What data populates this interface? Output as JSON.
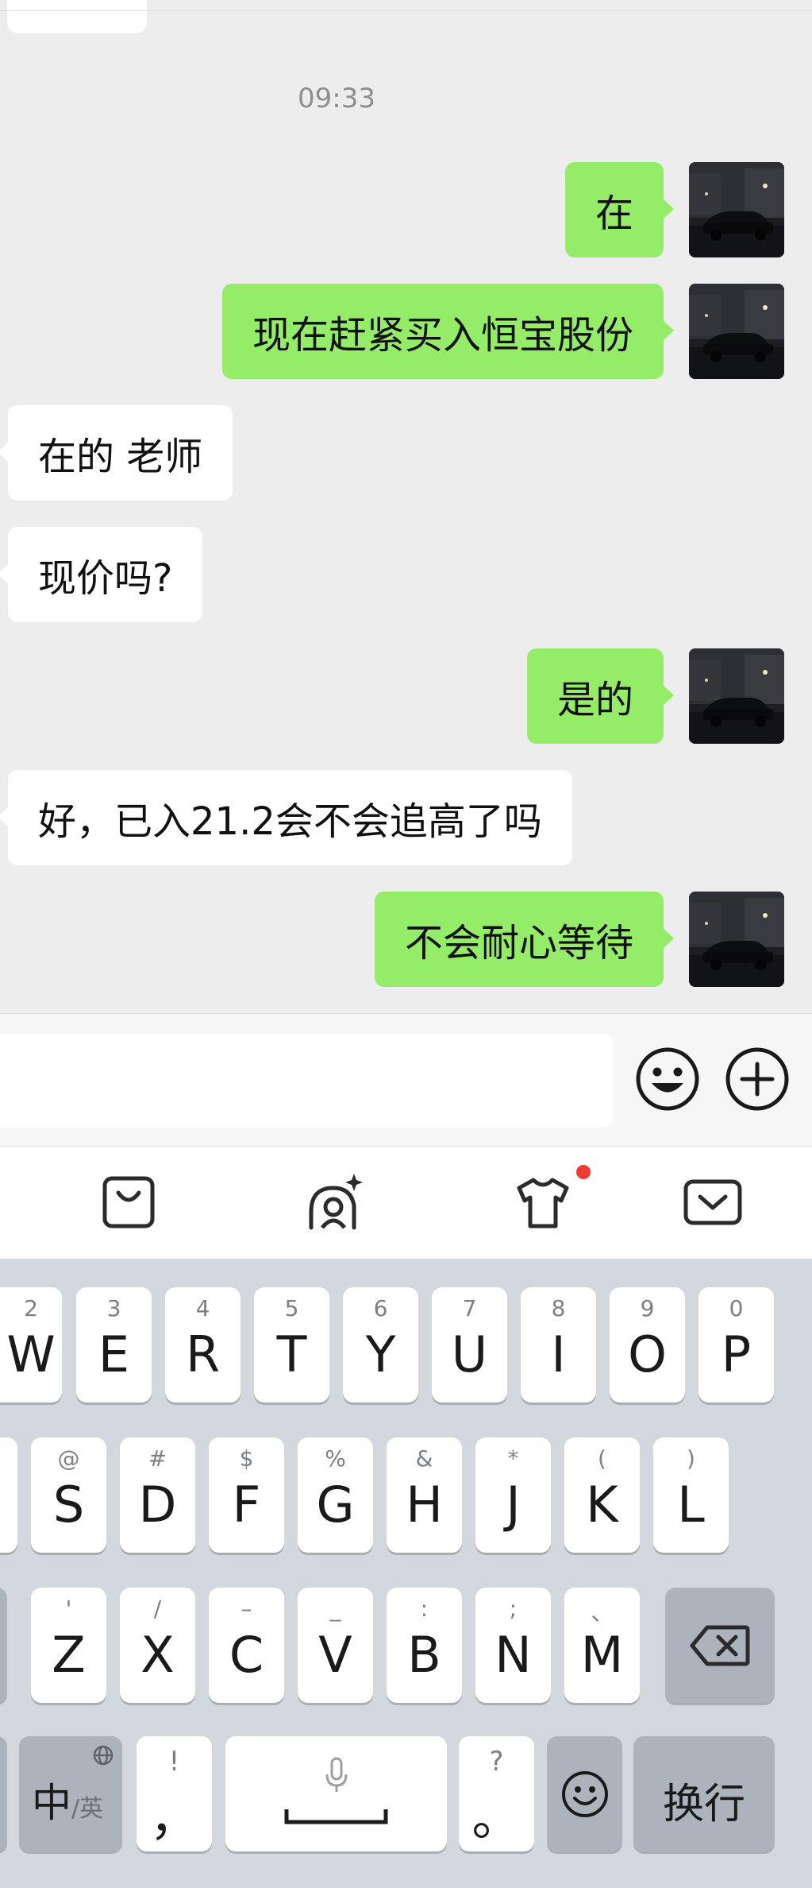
{
  "chat": {
    "timestamp": "09:33",
    "messages": [
      {
        "direction": "outgoing",
        "text": "在"
      },
      {
        "direction": "outgoing",
        "text": "现在赶紧买入恒宝股份"
      },
      {
        "direction": "incoming",
        "text": "在的 老师"
      },
      {
        "direction": "incoming",
        "text": "现价吗?"
      },
      {
        "direction": "outgoing",
        "text": "是的"
      },
      {
        "direction": "incoming",
        "text": "好，已入21.2会不会追高了吗"
      },
      {
        "direction": "outgoing",
        "text": "不会耐心等待"
      }
    ]
  },
  "input_bar": {
    "text_value": "",
    "icons": [
      "emoji-icon",
      "plus-circle-icon"
    ]
  },
  "keyboard_toolbar": {
    "icons": [
      "shopping-bag-icon",
      "avatar-sparkle-icon",
      "tshirt-icon",
      "collapse-keyboard-icon"
    ],
    "notification_dot_color": "#ee3b36"
  },
  "keyboard": {
    "row1": [
      {
        "hint": "2",
        "key": "W"
      },
      {
        "hint": "3",
        "key": "E"
      },
      {
        "hint": "4",
        "key": "R"
      },
      {
        "hint": "5",
        "key": "T"
      },
      {
        "hint": "6",
        "key": "Y"
      },
      {
        "hint": "7",
        "key": "U"
      },
      {
        "hint": "8",
        "key": "I"
      },
      {
        "hint": "9",
        "key": "O"
      },
      {
        "hint": "0",
        "key": "P"
      }
    ],
    "row2": [
      {
        "hint": "@",
        "key": "S"
      },
      {
        "hint": "#",
        "key": "D"
      },
      {
        "hint": "$",
        "key": "F"
      },
      {
        "hint": "%",
        "key": "G"
      },
      {
        "hint": "&",
        "key": "H"
      },
      {
        "hint": "*",
        "key": "J"
      },
      {
        "hint": "(",
        "key": "K"
      },
      {
        "hint": ")",
        "key": "L"
      }
    ],
    "row3": [
      {
        "hint": "'",
        "key": "Z"
      },
      {
        "hint": "/",
        "key": "X"
      },
      {
        "hint": "–",
        "key": "C"
      },
      {
        "hint": "_",
        "key": "V"
      },
      {
        "hint": ":",
        "key": "B"
      },
      {
        "hint": ";",
        "key": "N"
      },
      {
        "hint": "、",
        "key": "M"
      }
    ],
    "lang_main": "中",
    "lang_sub": "/英",
    "punct_comma_hint": "!",
    "punct_comma": "，",
    "punct_period_hint": "?",
    "punct_period": "。",
    "enter_label": "换行"
  },
  "colors": {
    "outgoing_bubble": "#95ec69",
    "incoming_bubble": "#ffffff",
    "chat_background": "#ededed",
    "keyboard_background": "#d3d7de"
  }
}
